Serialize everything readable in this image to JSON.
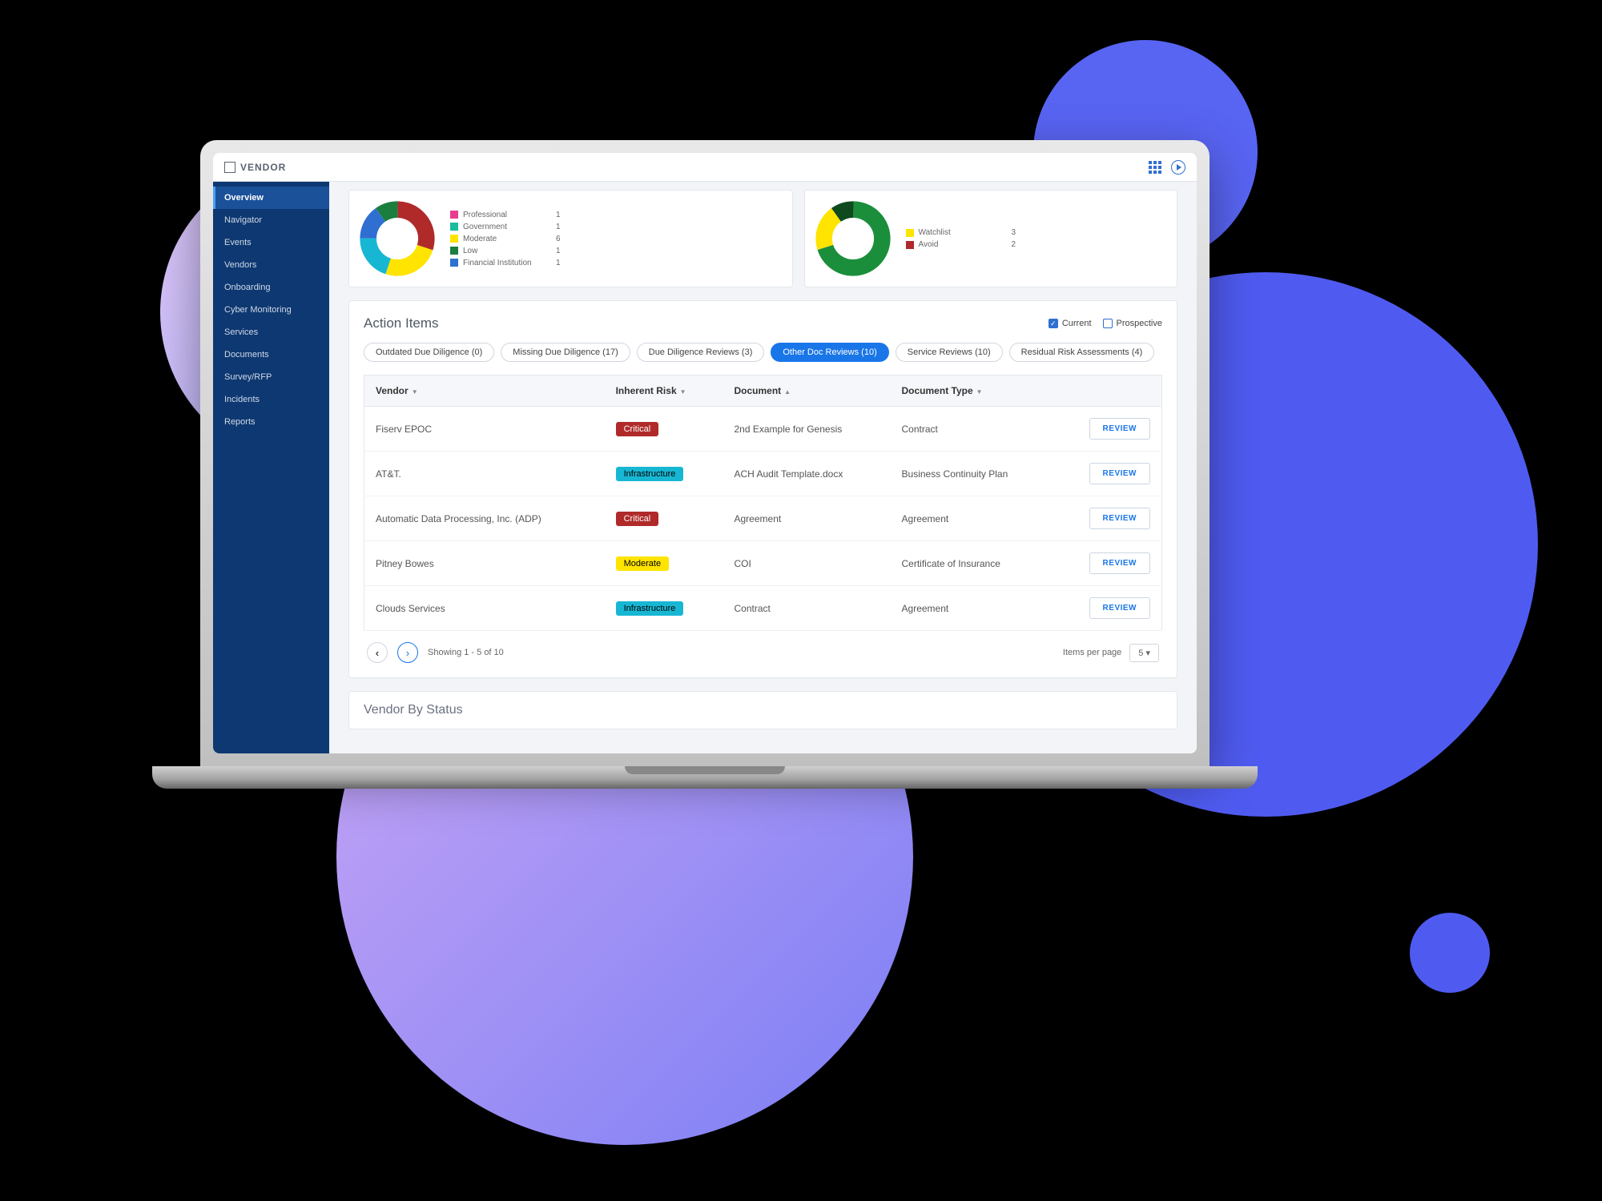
{
  "brand": "VENDOR",
  "sidebar": {
    "items": [
      "Overview",
      "Navigator",
      "Events",
      "Vendors",
      "Onboarding",
      "Cyber Monitoring",
      "Services",
      "Documents",
      "Survey/RFP",
      "Incidents",
      "Reports"
    ],
    "activeIndex": 0
  },
  "kpiLeft": {
    "legend": [
      {
        "label": "Professional",
        "value": 1,
        "color": "#e63e8f"
      },
      {
        "label": "Government",
        "value": 1,
        "color": "#1abc9c"
      },
      {
        "label": "Moderate",
        "value": 6,
        "color": "#ffe400"
      },
      {
        "label": "Low",
        "value": 1,
        "color": "#1b7e3e"
      },
      {
        "label": "Financial Institution",
        "value": 1,
        "color": "#2f6fd1"
      }
    ]
  },
  "kpiRight": {
    "legend": [
      {
        "label": "Watchlist",
        "value": 3,
        "color": "#ffe400"
      },
      {
        "label": "Avoid",
        "value": 2,
        "color": "#b02a2a"
      }
    ]
  },
  "actionItems": {
    "title": "Action Items",
    "filters": {
      "currentLabel": "Current",
      "currentChecked": true,
      "prospectiveLabel": "Prospective",
      "prospectiveChecked": false
    },
    "tabs": [
      {
        "label": "Outdated Due Diligence (0)",
        "active": false
      },
      {
        "label": "Missing Due Diligence (17)",
        "active": false
      },
      {
        "label": "Due Diligence Reviews (3)",
        "active": false
      },
      {
        "label": "Other Doc Reviews (10)",
        "active": true
      },
      {
        "label": "Service Reviews (10)",
        "active": false
      },
      {
        "label": "Residual Risk Assessments (4)",
        "active": false
      }
    ],
    "columns": [
      "Vendor",
      "Inherent Risk",
      "Document",
      "Document Type",
      ""
    ],
    "rows": [
      {
        "vendor": "Fiserv EPOC",
        "risk": "Critical",
        "riskClass": "critical",
        "document": "2nd Example for Genesis",
        "docType": "Contract"
      },
      {
        "vendor": "AT&T.",
        "risk": "Infrastructure",
        "riskClass": "infra",
        "document": "ACH Audit Template.docx",
        "docType": "Business Continuity Plan"
      },
      {
        "vendor": "Automatic Data Processing, Inc. (ADP)",
        "risk": "Critical",
        "riskClass": "critical",
        "document": "Agreement",
        "docType": "Agreement"
      },
      {
        "vendor": "Pitney Bowes",
        "risk": "Moderate",
        "riskClass": "moderate",
        "document": "COI",
        "docType": "Certificate of Insurance"
      },
      {
        "vendor": "Clouds Services",
        "risk": "Infrastructure",
        "riskClass": "infra",
        "document": "Contract",
        "docType": "Agreement"
      }
    ],
    "reviewLabel": "REVIEW",
    "pager": {
      "showing": "Showing 1 - 5 of 10",
      "perPageLabel": "Items per page",
      "perPage": "5"
    }
  },
  "nextSection": "Vendor By Status",
  "chart_data": [
    {
      "type": "pie",
      "title": "",
      "series": [
        {
          "name": "Red",
          "value": 30,
          "color": "#b02a2a"
        },
        {
          "name": "Yellow",
          "value": 25,
          "color": "#ffe400"
        },
        {
          "name": "Cyan",
          "value": 20,
          "color": "#17b7d4"
        },
        {
          "name": "Blue",
          "value": 15,
          "color": "#2f6fd1"
        },
        {
          "name": "Green",
          "value": 10,
          "color": "#1b7e3e"
        }
      ],
      "legend": [
        {
          "name": "Professional",
          "value": 1
        },
        {
          "name": "Government",
          "value": 1
        },
        {
          "name": "Moderate",
          "value": 6
        },
        {
          "name": "Low",
          "value": 1
        },
        {
          "name": "Financial Institution",
          "value": 1
        }
      ]
    },
    {
      "type": "pie",
      "title": "",
      "series": [
        {
          "name": "Green",
          "value": 70,
          "color": "#1b8e3c"
        },
        {
          "name": "Yellow",
          "value": 20,
          "color": "#ffe400"
        },
        {
          "name": "Dark",
          "value": 10,
          "color": "#0f4a1f"
        }
      ],
      "legend": [
        {
          "name": "Watchlist",
          "value": 3
        },
        {
          "name": "Avoid",
          "value": 2
        }
      ]
    }
  ]
}
